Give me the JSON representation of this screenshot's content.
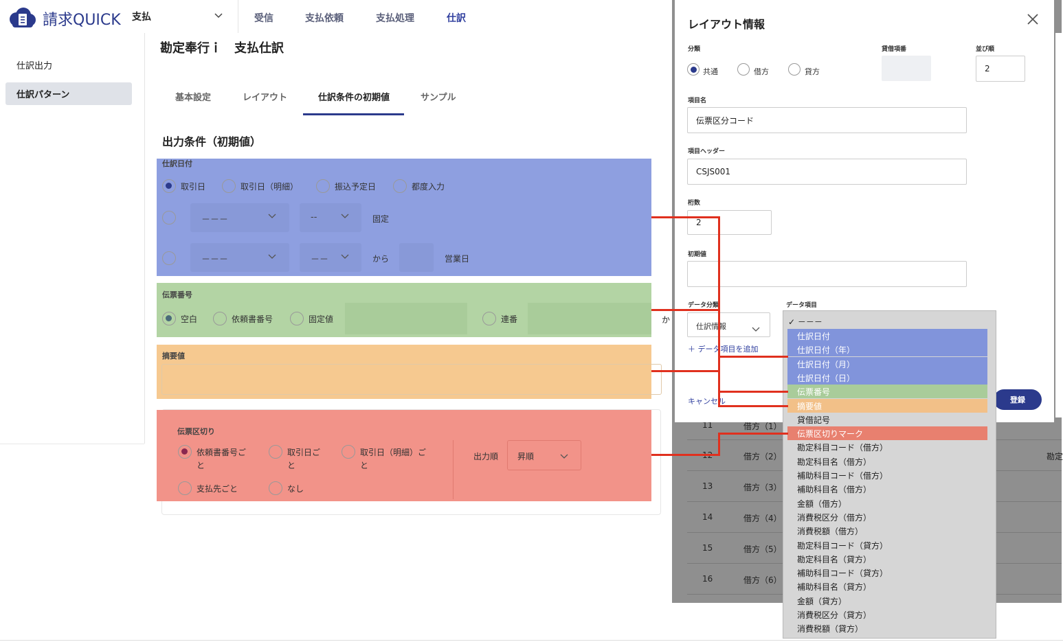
{
  "header": {
    "logo_text": "請求QUICK",
    "app_select": "支払",
    "nav": [
      "受信",
      "支払依頼",
      "支払処理",
      "仕訳"
    ]
  },
  "sidebar": {
    "items": [
      "仕訳出力",
      "仕訳パターン"
    ]
  },
  "page": {
    "title": "勘定奉行ｉ　支払仕訳",
    "tabs": [
      "基本設定",
      "レイアウト",
      "仕訳条件の初期値",
      "サンプル"
    ],
    "section_title": "出力条件（初期値）"
  },
  "journal_date": {
    "label": "仕訳日付",
    "options": [
      "取引日",
      "取引日（明細）",
      "振込予定日",
      "都度入力"
    ],
    "row2_select1": "－－－",
    "row2_select2": "--",
    "row2_suffix": "固定",
    "row3_select1": "－－－",
    "row3_select2": "－－",
    "row3_from": "から",
    "row3_suffix": "営業日"
  },
  "slip_number": {
    "label": "伝票番号",
    "options": [
      "空白",
      "依頼書番号",
      "固定値",
      "連番"
    ]
  },
  "summary": {
    "label": "摘要値"
  },
  "slip_break": {
    "label": "伝票区切り",
    "options": [
      "依頼書番号ご\nと",
      "取引日ご\nと",
      "取引日（明細）ご\nと",
      "支払先ごと",
      "なし"
    ],
    "order_label": "出力順",
    "order_value": "昇順"
  },
  "background_rows": {
    "nums": [
      "11",
      "12",
      "13",
      "14",
      "15",
      "16"
    ],
    "cols": [
      "借方（1）",
      "借方（2）",
      "借方（3）",
      "借方（4）",
      "借方（5）",
      "借方（6）"
    ],
    "side_text": "勘定",
    "ka": "か"
  },
  "modal": {
    "title": "レイアウト情報",
    "category_label": "分類",
    "category_options": [
      "共通",
      "借方",
      "貸方"
    ],
    "debit_credit_label": "貸借項番",
    "order_label": "並び順",
    "order_value": "2",
    "item_name_label": "項目名",
    "item_name_value": "伝票区分コード",
    "item_header_label": "項目ヘッダー",
    "item_header_value": "CSJS001",
    "digits_label": "桁数",
    "digits_value": "2",
    "initial_label": "初期値",
    "initial_value": "",
    "data_category_label": "データ分類",
    "data_category_value": "仕訳情報",
    "data_item_label": "データ項目",
    "add_link": "＋ データ項目を追加",
    "cancel": "キャンセル",
    "submit": "登録"
  },
  "dropdown": {
    "selected": "－－－",
    "items": [
      {
        "label": "仕訳日付",
        "color": "blue"
      },
      {
        "label": "仕訳日付（年）",
        "color": "blue"
      },
      {
        "label": "仕訳日付（月）",
        "color": "blue"
      },
      {
        "label": "仕訳日付（日）",
        "color": "blue"
      },
      {
        "label": "伝票番号",
        "color": "green"
      },
      {
        "label": "摘要値",
        "color": "orange"
      },
      {
        "label": "貸借記号",
        "color": ""
      },
      {
        "label": "伝票区切りマーク",
        "color": "red"
      },
      {
        "label": "勘定科目コード（借方）",
        "color": ""
      },
      {
        "label": "勘定科目名（借方）",
        "color": ""
      },
      {
        "label": "補助科目コード（借方）",
        "color": ""
      },
      {
        "label": "補助科目名（借方）",
        "color": ""
      },
      {
        "label": "金額（借方）",
        "color": ""
      },
      {
        "label": "消費税区分（借方）",
        "color": ""
      },
      {
        "label": "消費税額（借方）",
        "color": ""
      },
      {
        "label": "勘定科目コード（貸方）",
        "color": ""
      },
      {
        "label": "勘定科目名（貸方）",
        "color": ""
      },
      {
        "label": "補助科目コード（貸方）",
        "color": ""
      },
      {
        "label": "補助科目名（貸方）",
        "color": ""
      },
      {
        "label": "金額（貸方）",
        "color": ""
      },
      {
        "label": "消費税区分（貸方）",
        "color": ""
      },
      {
        "label": "消費税額（貸方）",
        "color": ""
      }
    ]
  },
  "colors": {
    "brand": "#2b3a8c",
    "blue_highlight": "#8e9fe0",
    "green_highlight": "#b3d4a4",
    "orange_highlight": "#f6c990",
    "red_highlight": "#f29389",
    "connector": "#e0301e"
  }
}
